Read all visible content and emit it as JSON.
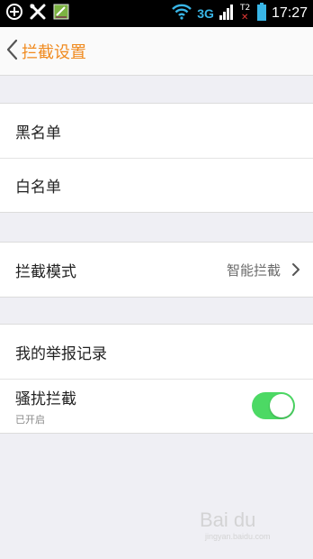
{
  "status_bar": {
    "network": "3G",
    "sim_label": "T2",
    "time": "17:27"
  },
  "header": {
    "title": "拦截设置"
  },
  "groups": [
    {
      "rows": [
        {
          "label": "黑名单"
        },
        {
          "label": "白名单"
        }
      ]
    },
    {
      "rows": [
        {
          "label": "拦截模式",
          "value": "智能拦截"
        }
      ]
    },
    {
      "rows": [
        {
          "label": "我的举报记录"
        },
        {
          "label": "骚扰拦截",
          "sublabel": "已开启",
          "toggle_on": true
        }
      ]
    }
  ],
  "watermark": {
    "text": "Bai du",
    "subtext": "jingyan.baidu.com"
  },
  "colors": {
    "accent": "#f08a1e",
    "toggle_on": "#4cd964",
    "background": "#efeff4"
  }
}
